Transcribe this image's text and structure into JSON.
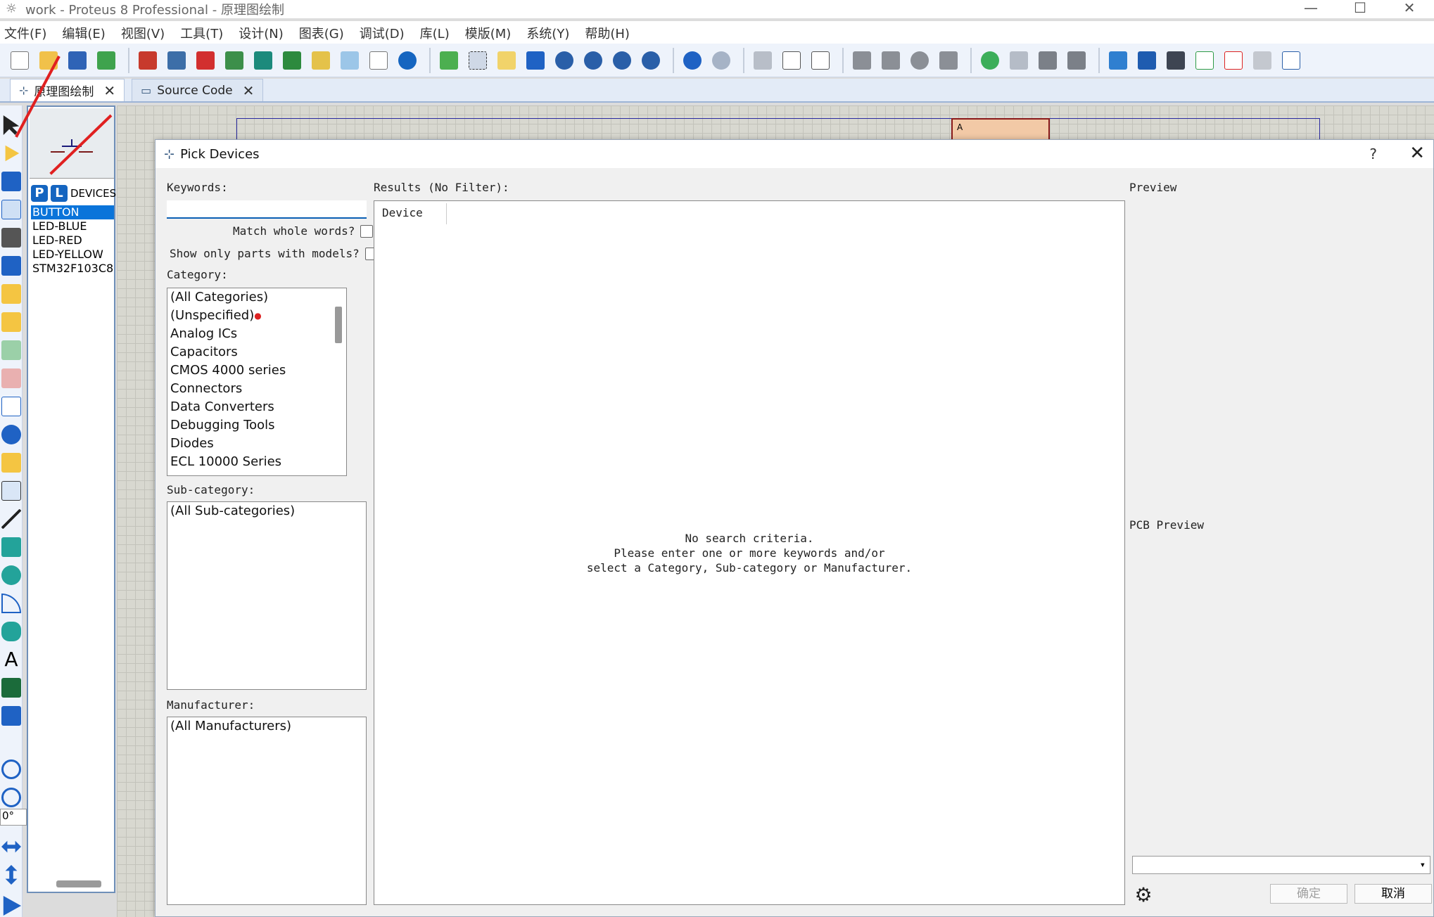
{
  "window": {
    "title": "work - Proteus 8 Professional - 原理图绘制",
    "controls": [
      "—",
      "☐",
      "✕"
    ]
  },
  "menu": [
    "文件(F)",
    "编辑(E)",
    "视图(V)",
    "工具(T)",
    "设计(N)",
    "图表(G)",
    "调试(D)",
    "库(L)",
    "模版(M)",
    "系统(Y)",
    "帮助(H)"
  ],
  "tabs": [
    {
      "label": "原理图绘制",
      "active": true
    },
    {
      "label": "Source Code",
      "active": false
    }
  ],
  "device_panel": {
    "p_label": "P",
    "l_label": "L",
    "header": "DEVICES",
    "items": [
      "BUTTON",
      "LED-BLUE",
      "LED-RED",
      "LED-YELLOW",
      "STM32F103C8"
    ],
    "selected": "BUTTON"
  },
  "angle": "0°",
  "canvas": {
    "chip_label": "A"
  },
  "dialog": {
    "title": "Pick Devices",
    "help": "?",
    "close": "✕",
    "keywords_label": "Keywords:",
    "keywords_value": "",
    "match_whole_words": "Match whole words?",
    "only_models": "Show only parts with models?",
    "category_label": "Category:",
    "categories": [
      "(All Categories)",
      "(Unspecified)",
      "Analog ICs",
      "Capacitors",
      "CMOS 4000 series",
      "Connectors",
      "Data Converters",
      "Debugging Tools",
      "Diodes",
      "ECL 10000 Series"
    ],
    "subcategory_label": "Sub-category:",
    "subcategories": [
      "(All Sub-categories)"
    ],
    "manufacturer_label": "Manufacturer:",
    "manufacturers": [
      "(All Manufacturers)"
    ],
    "results_label": "Results (No Filter):",
    "results_column": "Device",
    "no_criteria_lines": [
      "No search criteria.",
      "Please enter one or more keywords and/or",
      "select a Category, Sub-category or Manufacturer."
    ],
    "preview_label": "Preview",
    "pcb_preview_label": "PCB Preview",
    "ok_label": "确定",
    "cancel_label": "取消"
  },
  "colors": {
    "selection": "#0a74da",
    "accent_blue": "#1565c0",
    "annotation_red": "#e02020"
  }
}
